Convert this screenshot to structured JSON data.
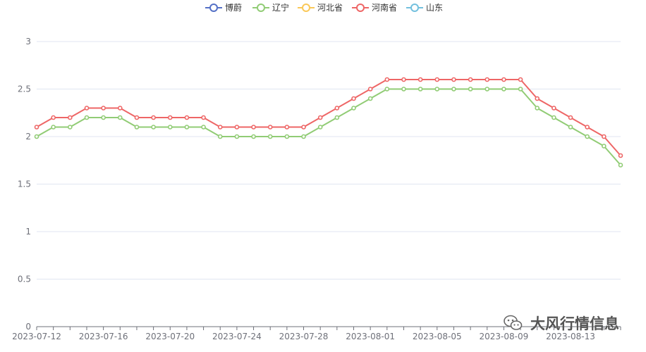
{
  "chart_data": {
    "type": "line",
    "title": "",
    "xlabel": "",
    "ylabel": "",
    "ylim": [
      0,
      3
    ],
    "yticks": [
      0,
      0.5,
      1,
      1.5,
      2,
      2.5,
      3
    ],
    "ytick_labels": [
      "0",
      "0.5",
      "1",
      "1.5",
      "2",
      "2.5",
      "3"
    ],
    "grid": "horizontal",
    "legend_position": "top-center",
    "x": [
      "2023-07-12",
      "2023-07-13",
      "2023-07-14",
      "2023-07-15",
      "2023-07-16",
      "2023-07-17",
      "2023-07-18",
      "2023-07-19",
      "2023-07-20",
      "2023-07-21",
      "2023-07-22",
      "2023-07-23",
      "2023-07-24",
      "2023-07-25",
      "2023-07-26",
      "2023-07-27",
      "2023-07-28",
      "2023-07-29",
      "2023-07-30",
      "2023-07-31",
      "2023-08-01",
      "2023-08-02",
      "2023-08-03",
      "2023-08-04",
      "2023-08-05",
      "2023-08-06",
      "2023-08-07",
      "2023-08-08",
      "2023-08-09",
      "2023-08-10",
      "2023-08-11",
      "2023-08-12",
      "2023-08-13",
      "2023-08-14",
      "2023-08-15",
      "2023-08-16"
    ],
    "xtick_labels": [
      "2023-07-12",
      "2023-07-16",
      "2023-07-20",
      "2023-07-24",
      "2023-07-28",
      "2023-08-01",
      "2023-08-05",
      "2023-08-09",
      "2023-08-13"
    ],
    "series": [
      {
        "name": "博蔚",
        "color": "#5470c6",
        "values": []
      },
      {
        "name": "辽宁",
        "color": "#91cc75",
        "values": [
          2.0,
          2.1,
          2.1,
          2.2,
          2.2,
          2.2,
          2.1,
          2.1,
          2.1,
          2.1,
          2.1,
          2.0,
          2.0,
          2.0,
          2.0,
          2.0,
          2.0,
          2.1,
          2.2,
          2.3,
          2.4,
          2.5,
          2.5,
          2.5,
          2.5,
          2.5,
          2.5,
          2.5,
          2.5,
          2.5,
          2.3,
          2.2,
          2.1,
          2.0,
          1.9,
          1.7
        ]
      },
      {
        "name": "河北省",
        "color": "#fac858",
        "values": []
      },
      {
        "name": "河南省",
        "color": "#ee6666",
        "values": [
          2.1,
          2.2,
          2.2,
          2.3,
          2.3,
          2.3,
          2.2,
          2.2,
          2.2,
          2.2,
          2.2,
          2.1,
          2.1,
          2.1,
          2.1,
          2.1,
          2.1,
          2.2,
          2.3,
          2.4,
          2.5,
          2.6,
          2.6,
          2.6,
          2.6,
          2.6,
          2.6,
          2.6,
          2.6,
          2.6,
          2.4,
          2.3,
          2.2,
          2.1,
          2.0,
          1.8
        ]
      },
      {
        "name": "山东",
        "color": "#73c0de",
        "values": []
      }
    ]
  },
  "watermark": {
    "text": "大风行情信息",
    "icon": "wechat-icon"
  }
}
